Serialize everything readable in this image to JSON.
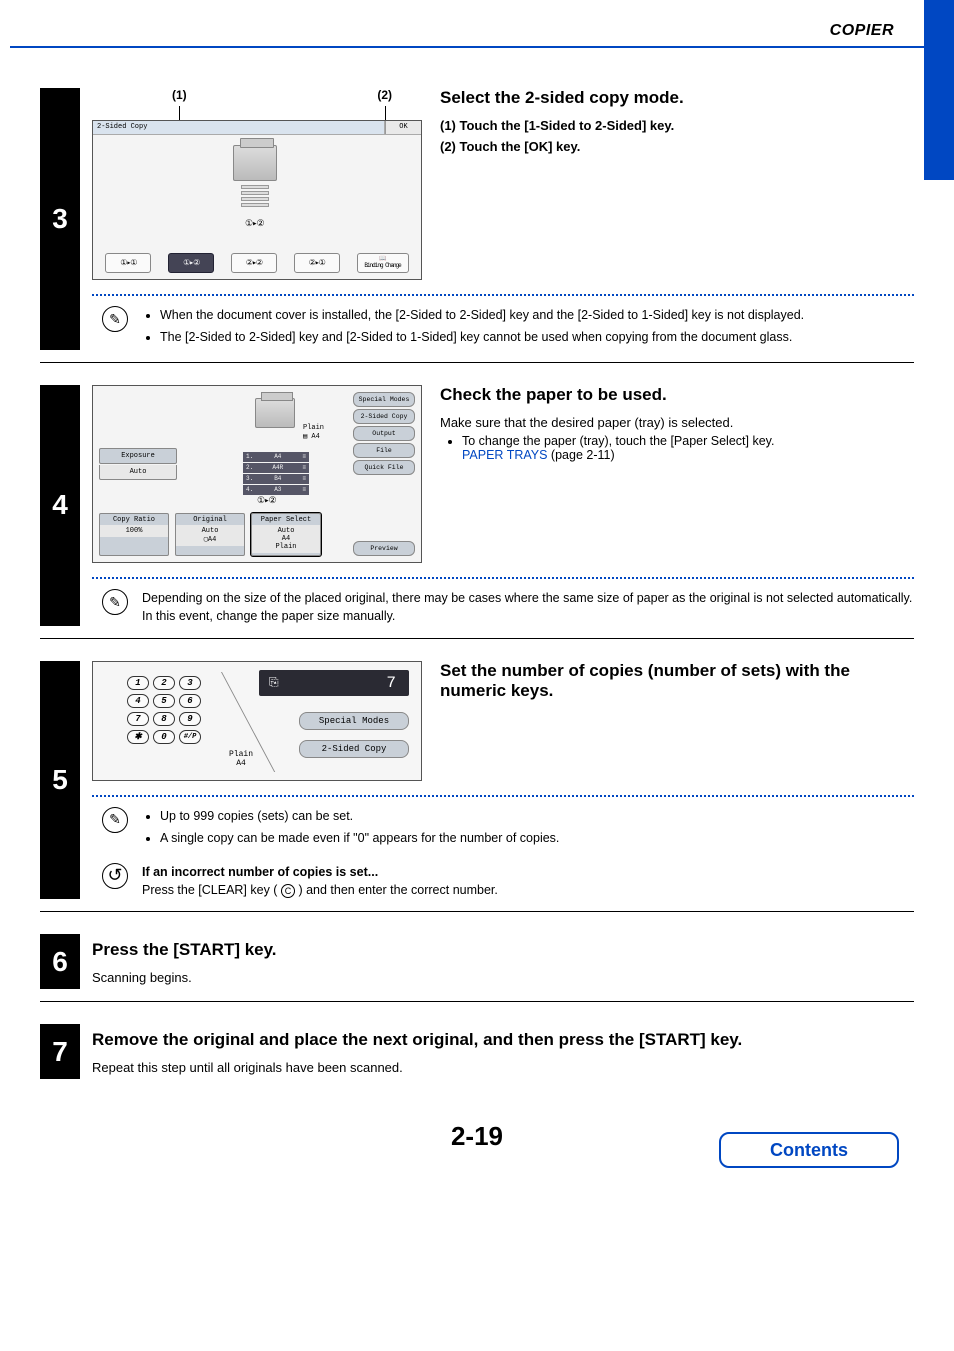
{
  "header": {
    "chapter": "COPIER"
  },
  "steps": {
    "s3": {
      "num": "3",
      "title": "Select the 2-sided copy mode.",
      "sub1": "(1)  Touch the [1-Sided to 2-Sided] key.",
      "sub2": "(2)  Touch the [OK] key.",
      "callout1": "(1)",
      "callout2": "(2)",
      "panel_title": "2-Sided Copy",
      "ok": "OK",
      "binding": "Binding Change",
      "mode_icons": [
        "①▸①",
        "①▸②",
        "②▸②",
        "②▸①"
      ],
      "note1": "When the document cover is installed, the [2-Sided to 2-Sided] key and the [2-Sided to 1-Sided] key is not displayed.",
      "note2": "The [2-Sided to 2-Sided] key and [2-Sided to 1-Sided] key cannot be used when copying from the document glass."
    },
    "s4": {
      "num": "4",
      "title": "Check the paper to be used.",
      "body": "Make sure that the desired paper (tray) is selected.",
      "bullet": "To change the paper (tray), touch the [Paper Select] key.",
      "link": "PAPER TRAYS",
      "link_page": " (page 2-11)",
      "panel": {
        "plain": "Plain",
        "a4": "A4",
        "trays": [
          {
            "n": "1.",
            "s": "A4"
          },
          {
            "n": "2.",
            "s": "A4R"
          },
          {
            "n": "3.",
            "s": "B4"
          },
          {
            "n": "4.",
            "s": "A3"
          }
        ],
        "exposure": "Exposure",
        "auto": "Auto",
        "copy_ratio": "Copy Ratio",
        "ratio_val": "100%",
        "original": "Original",
        "original_val": "Auto",
        "paper_select": "Paper Select",
        "paper_val1": "Auto",
        "paper_val2": "A4",
        "paper_val3": "Plain",
        "right_btns": [
          "Special Modes",
          "2-Sided Copy",
          "Output",
          "File",
          "Quick File"
        ],
        "preview": "Preview"
      },
      "note": "Depending on the size of the placed original, there may be cases where the same size of paper as the original is not selected automatically. In this event, change the paper size manually."
    },
    "s5": {
      "num": "5",
      "title": "Set the number of copies (number of sets) with the numeric keys.",
      "keys": [
        "1",
        "2",
        "3",
        "4",
        "5",
        "6",
        "7",
        "8",
        "9",
        "✱",
        "0",
        "#/P"
      ],
      "display": "7",
      "btn1": "Special Modes",
      "btn2": "2-Sided Copy",
      "plain": "Plain",
      "a4": "A4",
      "note1": "Up to 999 copies (sets) can be set.",
      "note2": "A single copy can be made even if \"0\" appears for the number of copies.",
      "tip_title": "If an incorrect number of copies is set...",
      "tip_body_a": "Press the [CLEAR] key (",
      "tip_body_b": ") and then enter the correct number.",
      "clear_key": "C"
    },
    "s6": {
      "num": "6",
      "title": "Press the [START] key.",
      "body": "Scanning begins."
    },
    "s7": {
      "num": "7",
      "title": "Remove the original and place the next original, and then press the [START] key.",
      "body": "Repeat this step until all originals have been scanned."
    }
  },
  "footer": {
    "page": "2-19",
    "contents": "Contents"
  }
}
